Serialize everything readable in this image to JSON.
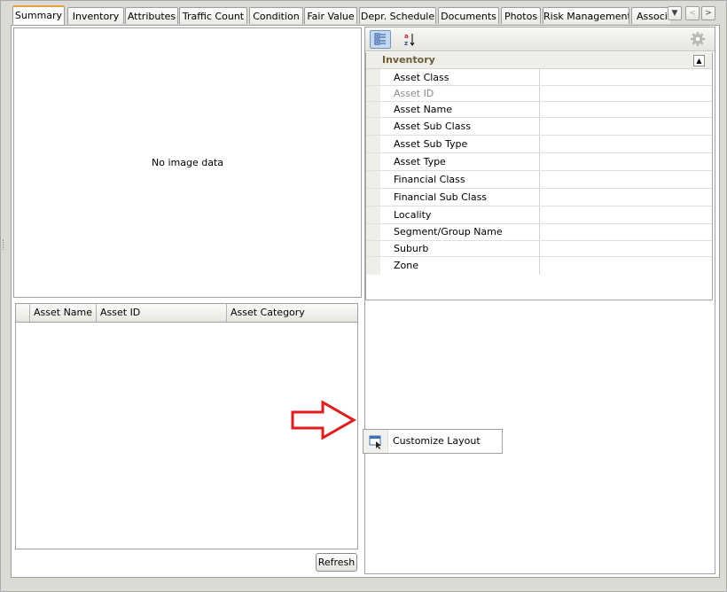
{
  "tabs": [
    {
      "label": "Summary",
      "active": true
    },
    {
      "label": "Inventory"
    },
    {
      "label": "Attributes"
    },
    {
      "label": "Traffic Count"
    },
    {
      "label": "Condition"
    },
    {
      "label": "Fair Value"
    },
    {
      "label": "Depr. Schedule"
    },
    {
      "label": "Documents"
    },
    {
      "label": "Photos"
    },
    {
      "label": "Risk Management"
    },
    {
      "label": "Associ"
    }
  ],
  "image_pane": {
    "placeholder": "No image data"
  },
  "grid": {
    "columns": [
      "Asset Name",
      "Asset ID",
      "Asset Category"
    ]
  },
  "refresh_label": "Refresh",
  "property_grid": {
    "category": "Inventory",
    "properties": [
      {
        "name": "Asset Class",
        "value": ""
      },
      {
        "name": "Asset ID",
        "value": "",
        "disabled": true
      },
      {
        "name": "Asset Name",
        "value": ""
      },
      {
        "name": "Asset Sub Class",
        "value": ""
      },
      {
        "name": "Asset Sub Type",
        "value": ""
      },
      {
        "name": "Asset Type",
        "value": ""
      },
      {
        "name": "Financial Class",
        "value": ""
      },
      {
        "name": "Financial Sub Class",
        "value": ""
      },
      {
        "name": "Locality",
        "value": ""
      },
      {
        "name": "Segment/Group Name",
        "value": ""
      },
      {
        "name": "Suburb",
        "value": ""
      },
      {
        "name": "Zone",
        "value": ""
      }
    ]
  },
  "context_menu": {
    "item": "Customize Layout"
  },
  "colors": {
    "accent_tab": "#e8a23a",
    "arrow": "#e31b1b",
    "selected_tool": "#c6d9f1"
  }
}
